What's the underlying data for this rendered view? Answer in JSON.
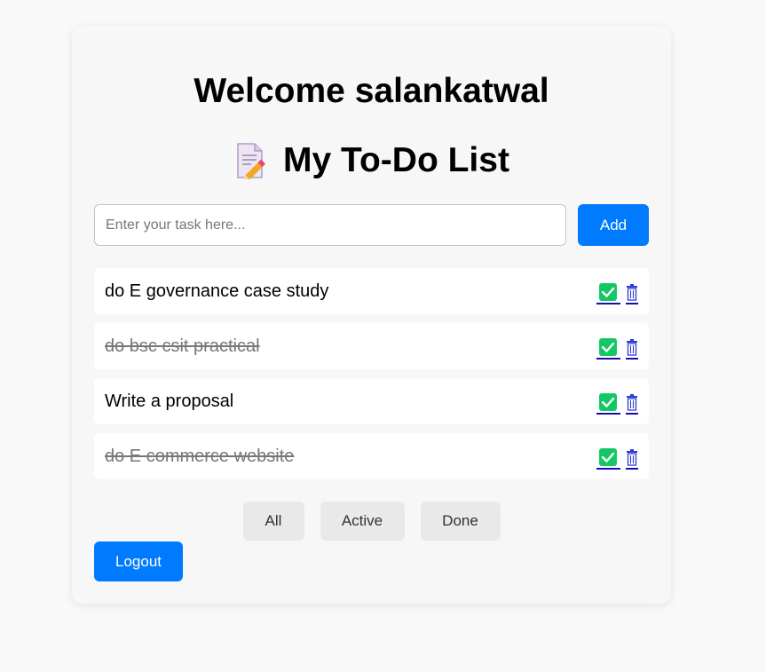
{
  "header": {
    "welcome": "Welcome salankatwal",
    "list_title": "My To-Do List",
    "title_icon": "memo-pencil-icon"
  },
  "input": {
    "placeholder": "Enter your task here...",
    "value": "",
    "add_label": "Add"
  },
  "todos": [
    {
      "text": "do E governance case study",
      "done": false
    },
    {
      "text": "do bsc csit practical",
      "done": true
    },
    {
      "text": "Write a proposal",
      "done": false
    },
    {
      "text": "do E commerce website",
      "done": true
    }
  ],
  "item_icons": {
    "complete": "check-mark-icon",
    "delete": "trash-icon"
  },
  "filters": {
    "all": "All",
    "active": "Active",
    "done": "Done"
  },
  "logout_label": "Logout",
  "colors": {
    "primary": "#007bff",
    "check": "#14c765",
    "trash": "#2c3ad6",
    "card": "#f7f7f7",
    "filter_bg": "#e9e9e9"
  }
}
